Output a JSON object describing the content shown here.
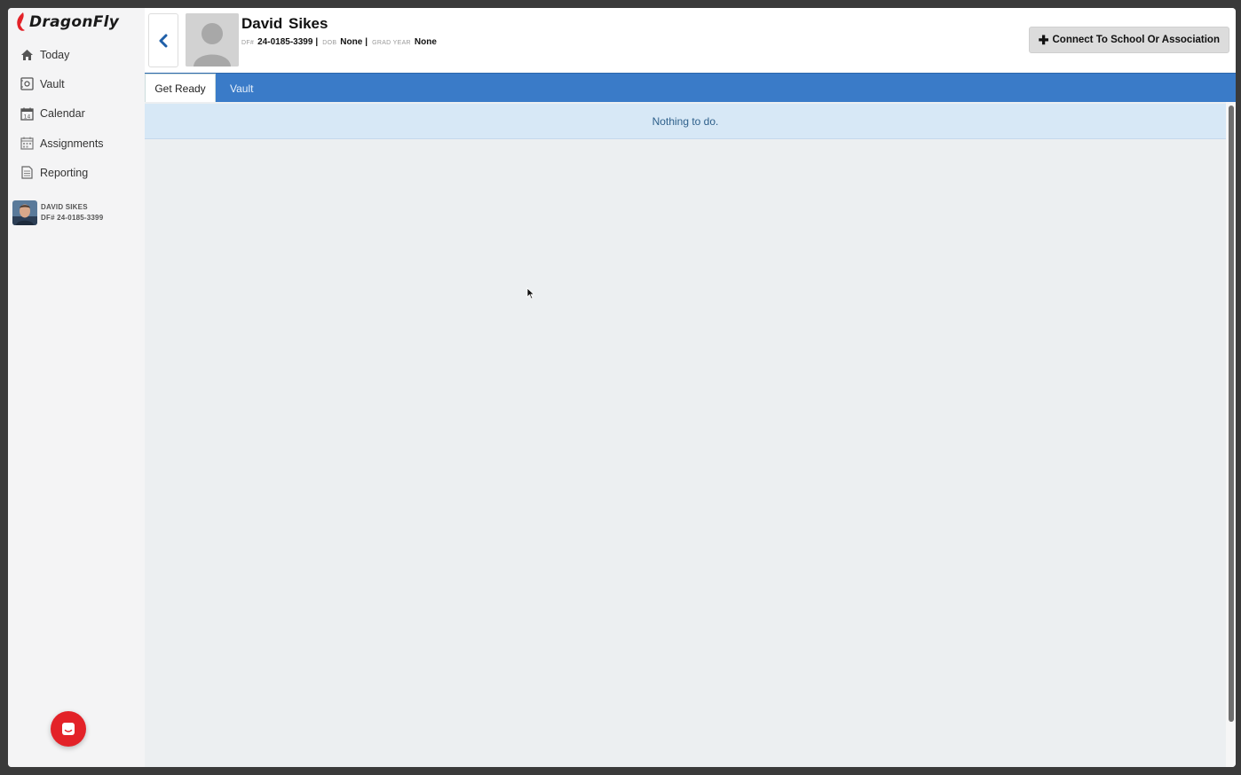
{
  "app": {
    "brand": "DragonFly",
    "accent_color": "#3a7bc8",
    "brand_red": "#e32228"
  },
  "sidebar": {
    "items": [
      {
        "label": "Today",
        "icon": "home-icon"
      },
      {
        "label": "Vault",
        "icon": "vault-icon"
      },
      {
        "label": "Calendar",
        "icon": "calendar-icon"
      },
      {
        "label": "Assignments",
        "icon": "assignments-icon"
      },
      {
        "label": "Reporting",
        "icon": "document-icon"
      }
    ],
    "user": {
      "name": "DAVID SIKES",
      "df_number": "DF# 24-0185-3399"
    },
    "chat_icon": "chat-icon"
  },
  "header": {
    "name": "David Sikes",
    "df_label": "DF#",
    "df_value": "24-0185-3399",
    "dob_label": "DOB",
    "dob_value": "None",
    "grad_label": "GRAD YEAR",
    "grad_value": "None",
    "connect_button": "Connect To School Or Association"
  },
  "tabs": [
    {
      "label": "Get Ready",
      "active": true
    },
    {
      "label": "Vault",
      "active": false
    }
  ],
  "content": {
    "message": "Nothing to do."
  }
}
